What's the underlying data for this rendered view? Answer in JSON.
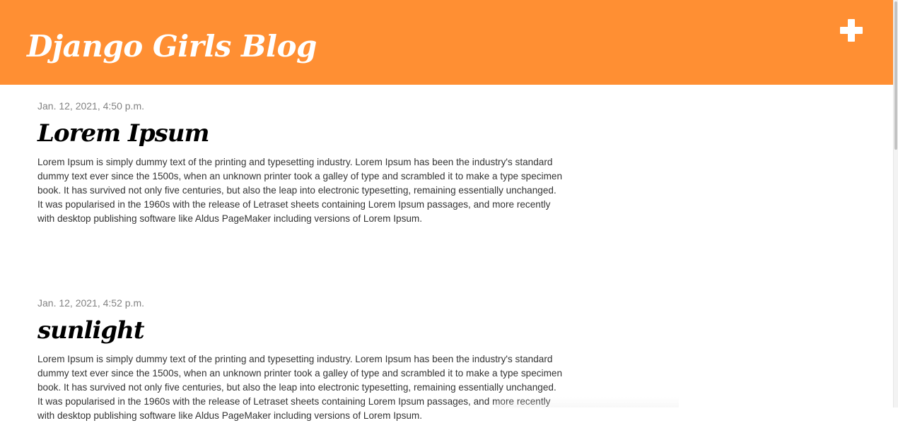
{
  "header": {
    "site_title": "Django Girls Blog",
    "add_icon": "plus-icon",
    "accent_color": "#ff8f33"
  },
  "posts": [
    {
      "date": "Jan. 12, 2021, 4:50 p.m.",
      "title": "Lorem Ipsum",
      "body": "Lorem Ipsum is simply dummy text of the printing and typesetting industry. Lorem Ipsum has been the industry's standard dummy text ever since the 1500s, when an unknown printer took a galley of type and scrambled it to make a type specimen book. It has survived not only five centuries, but also the leap into electronic typesetting, remaining essentially unchanged. It was popularised in the 1960s with the release of Letraset sheets containing Lorem Ipsum passages, and more recently with desktop publishing software like Aldus PageMaker including versions of Lorem Ipsum."
    },
    {
      "date": "Jan. 12, 2021, 4:52 p.m.",
      "title": "sunlight",
      "body": "Lorem Ipsum is simply dummy text of the printing and typesetting industry. Lorem Ipsum has been the industry's standard dummy text ever since the 1500s, when an unknown printer took a galley of type and scrambled it to make a type specimen book. It has survived not only five centuries, but also the leap into electronic typesetting, remaining essentially unchanged. It was popularised in the 1960s with the release of Letraset sheets containing Lorem Ipsum passages, and more recently with desktop publishing software like Aldus PageMaker including versions of Lorem Ipsum."
    }
  ]
}
